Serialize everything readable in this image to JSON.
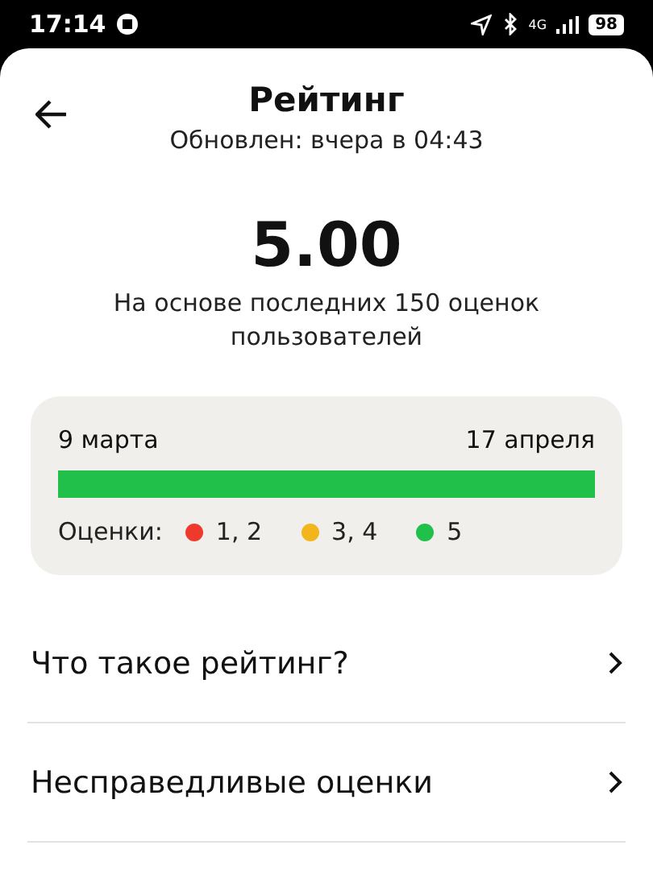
{
  "status_bar": {
    "time": "17:14",
    "network": "4G",
    "battery": "98"
  },
  "header": {
    "title": "Рейтинг",
    "subtitle": "Обновлен: вчера в 04:43"
  },
  "rating": {
    "value": "5.00",
    "description": "На основе последних 150 оценок пользователей"
  },
  "history": {
    "start": "9 марта",
    "end": "17 апреля",
    "segments": [
      {
        "color": "#21c04a",
        "level": 1
      }
    ],
    "legend_label": "Оценки:",
    "legend": [
      {
        "label": "1, 2",
        "color": "#ee3a2c"
      },
      {
        "label": "3, 4",
        "color": "#f2b61c"
      },
      {
        "label": "5",
        "color": "#21c04a"
      }
    ]
  },
  "menu": [
    {
      "label": "Что такое рейтинг?"
    },
    {
      "label": "Несправедливые оценки"
    }
  ]
}
